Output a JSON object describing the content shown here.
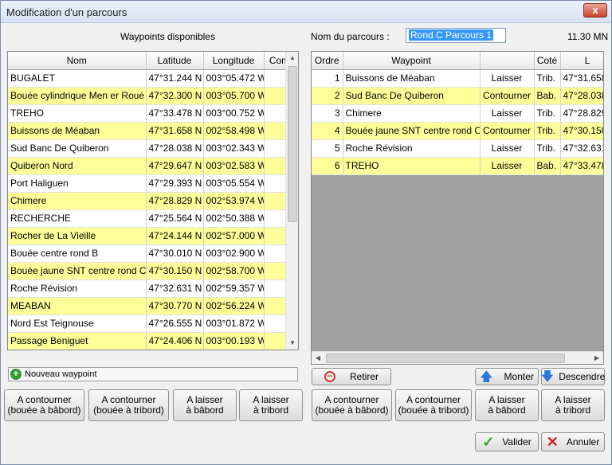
{
  "window": {
    "title": "Modification d'un parcours",
    "close_glyph": "x"
  },
  "labels": {
    "available": "Waypoints disponibles",
    "route_name_label": "Nom du parcours :",
    "route_name_value": "Rond C Parcours 1",
    "distance": "11.30 MN"
  },
  "left_table": {
    "headers": [
      "Nom",
      "Latitude",
      "Longitude",
      "Com"
    ],
    "rows": [
      [
        "BUGALET",
        "47°31.244 N",
        "003°05.472 W",
        ""
      ],
      [
        "Bouée cylindrique Men er Roué",
        "47°32.300 N",
        "003°05.700 W",
        ""
      ],
      [
        "TREHO",
        "47°33.478 N",
        "003°00.752 W",
        ""
      ],
      [
        "Buissons de Méaban",
        "47°31.658 N",
        "002°58.498 W",
        ""
      ],
      [
        "Sud Banc De Quiberon",
        "47°28.038 N",
        "003°02.343 W",
        ""
      ],
      [
        "Quiberon Nord",
        "47°29.647 N",
        "003°02.583 W",
        ""
      ],
      [
        "Port Haliguen",
        "47°29.393 N",
        "003°05.554 W",
        ""
      ],
      [
        "Chimere",
        "47°28.829 N",
        "002°53.974 W",
        ""
      ],
      [
        "RECHERCHE",
        "47°25.564 N",
        "002°50.388 W",
        ""
      ],
      [
        "Rocher de La Vieille",
        "47°24.144 N",
        "002°57.000 W",
        ""
      ],
      [
        "Bouée centre rond B",
        "47°30.010 N",
        "003°02.900 W",
        ""
      ],
      [
        "Bouée jaune SNT centre rond C",
        "47°30.150 N",
        "002°58.700 W",
        ""
      ],
      [
        "Roche Révision",
        "47°32.631 N",
        "002°59.357 W",
        ""
      ],
      [
        "MEABAN",
        "47°30.770 N",
        "002°56.224 W",
        ""
      ],
      [
        "Nord Est Teignouse",
        "47°26.555 N",
        "003°01.872 W",
        ""
      ],
      [
        "Passage Beniguet",
        "47°24.406 N",
        "003°00.193 W",
        ""
      ]
    ]
  },
  "right_table": {
    "headers": [
      "Ordre",
      "Waypoint",
      "",
      "Coté",
      "L"
    ],
    "rows": [
      [
        "1",
        "Buissons de Méaban",
        "Laisser",
        "Trib.",
        "47°31.658"
      ],
      [
        "2",
        "Sud Banc De Quiberon",
        "Contourner",
        "Bab.",
        "47°28.038"
      ],
      [
        "3",
        "Chimere",
        "Laisser",
        "Trib.",
        "47°28.829"
      ],
      [
        "4",
        "Bouée jaune SNT centre rond C",
        "Contourner",
        "Trib.",
        "47°30.150"
      ],
      [
        "5",
        "Roche Révision",
        "Laisser",
        "Trib.",
        "47°32.631"
      ],
      [
        "6",
        "TREHO",
        "Laisser",
        "Bab.",
        "47°33.478"
      ]
    ]
  },
  "buttons": {
    "new_waypoint": "Nouveau waypoint",
    "retirer": "Retirer",
    "monter": "Monter",
    "descendre": "Descendre",
    "contourner_bab_1": "A contourner",
    "contourner_bab_2": "(bouée à bâbord)",
    "contourner_trib_1": "A contourner",
    "contourner_trib_2": "(bouée à tribord)",
    "laisser_bab_1": "A laisser",
    "laisser_bab_2": "à bâbord",
    "laisser_trib_1": "A laisser",
    "laisser_trib_2": "à tribord",
    "valider": "Valider",
    "annuler": "Annuler"
  },
  "icons": {
    "plus": "+",
    "minus": "−",
    "check": "✓",
    "cross": "✕",
    "up": "🡅",
    "down": "🡇"
  },
  "colors": {
    "row_highlight": "#ffff99"
  }
}
